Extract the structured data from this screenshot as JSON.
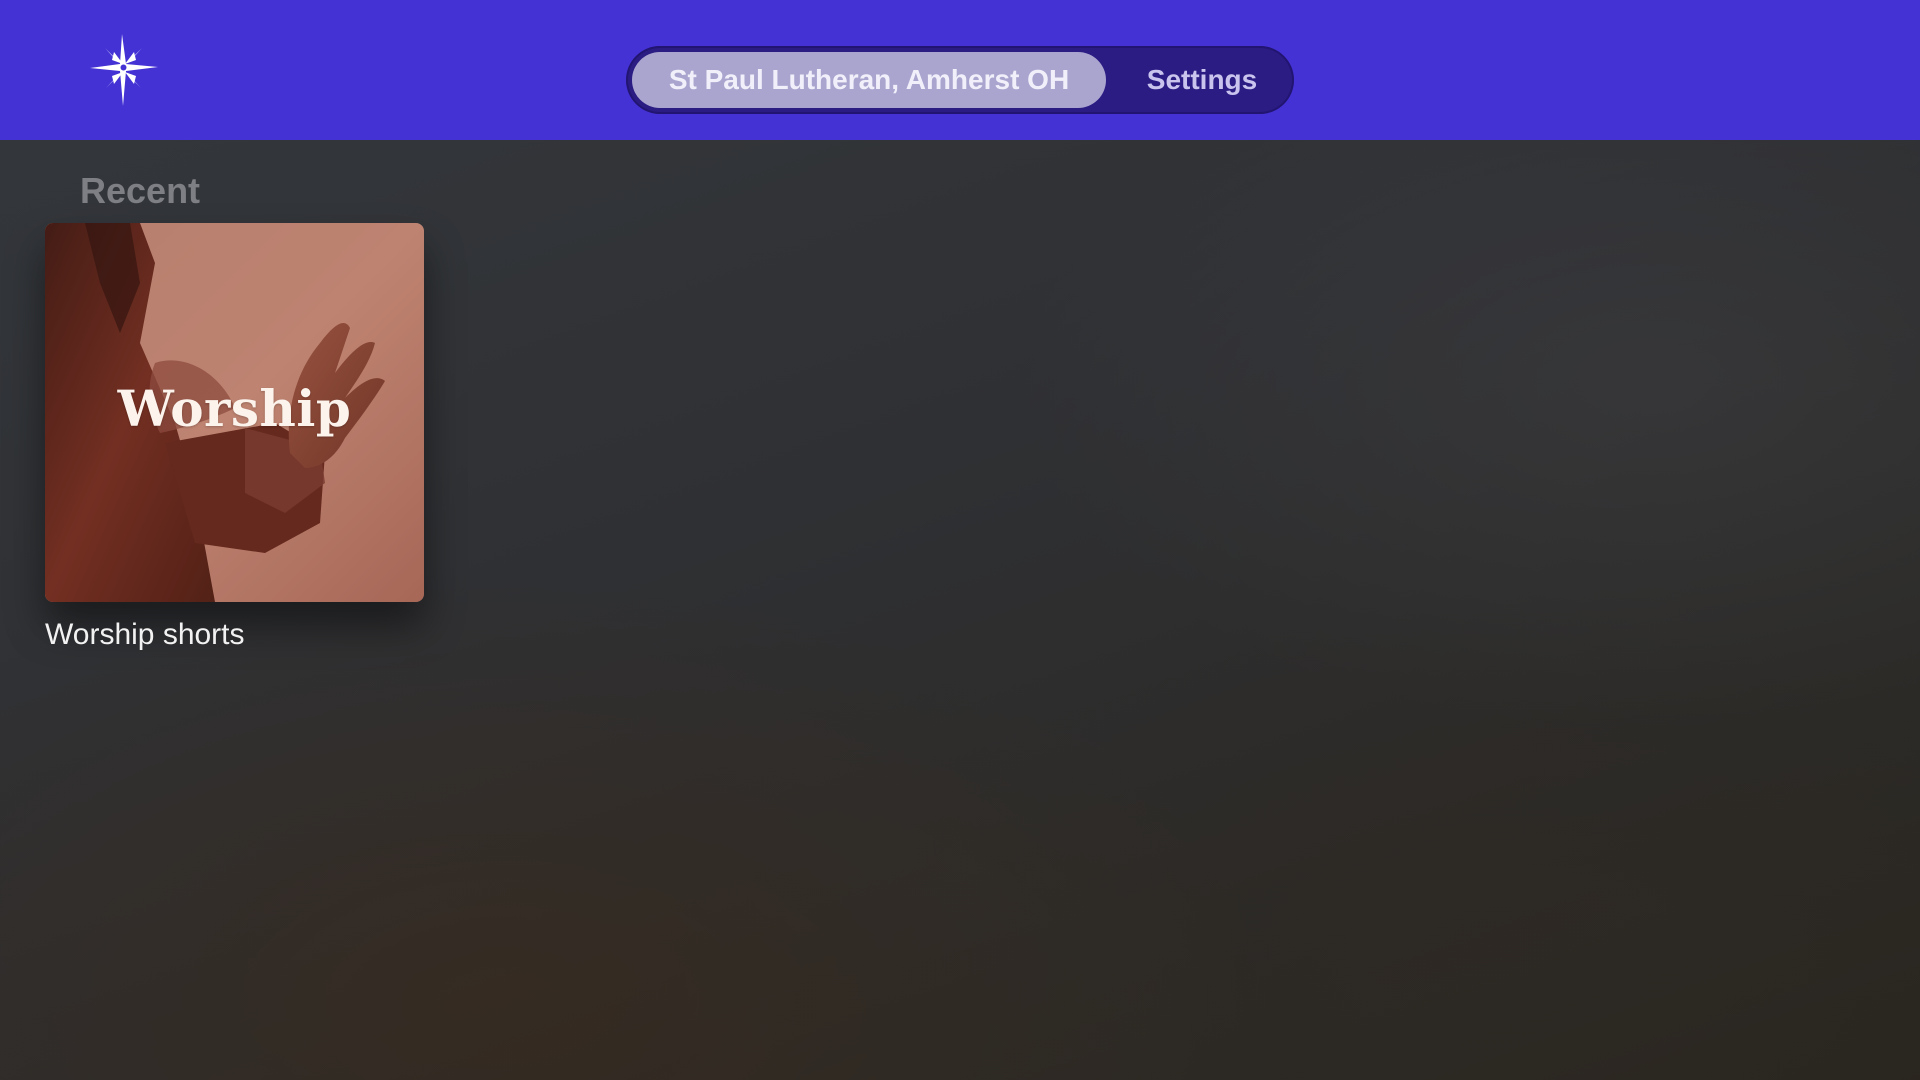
{
  "header": {
    "logo_icon": "star-cross-icon",
    "tabs": [
      {
        "label": "St Paul Lutheran, Amherst OH",
        "active": true
      },
      {
        "label": "Settings",
        "active": false
      }
    ]
  },
  "recent": {
    "title": "Recent",
    "items": [
      {
        "artwork_text": "Worship",
        "caption": "Worship shorts"
      }
    ]
  },
  "colors": {
    "header_bg": "#4432d5",
    "pill_bg": "#2a1c83",
    "active_tab_bg": "#a9a5cf"
  }
}
